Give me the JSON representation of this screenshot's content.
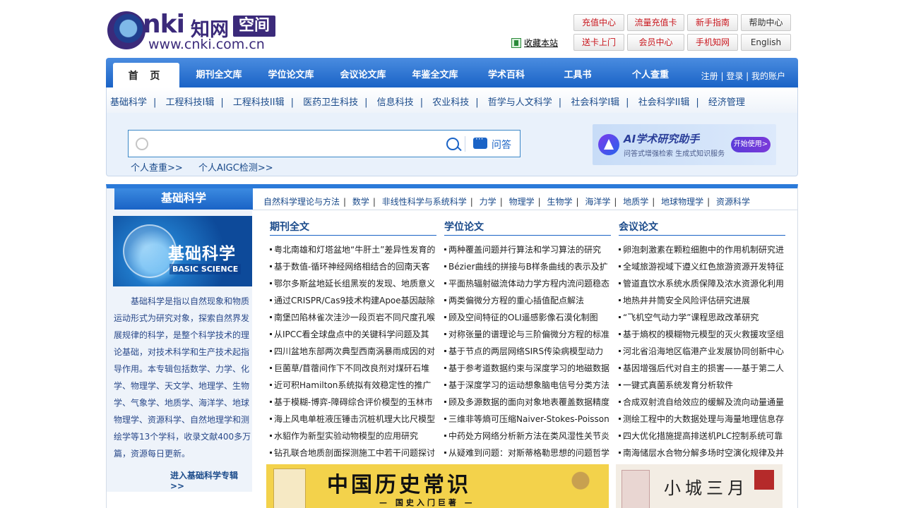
{
  "logo": {
    "brand": "nki",
    "cn": "知网",
    "box": "空间",
    "url": "www.cnki.com.cn"
  },
  "header": {
    "favorite": "收藏本站",
    "buttons_row1": [
      "充值中心",
      "流量充值卡",
      "新手指南",
      "帮助中心"
    ],
    "buttons_row2": [
      "送卡上门",
      "会员中心",
      "手机知网",
      "English"
    ]
  },
  "nav": {
    "home": "首 页",
    "items": [
      "期刊全文库",
      "学位论文库",
      "会议论文库",
      "年鉴全文库",
      "学术百科",
      "工具书",
      "个人查重"
    ],
    "account": "注册 | 登录 | 我的账户"
  },
  "subnav": [
    "基础科学",
    "工程科技I辑",
    "工程科技II辑",
    "医药卫生科技",
    "信息科技",
    "农业科技",
    "哲学与人文科学",
    "社会科学I辑",
    "社会科学II辑",
    "经济管理"
  ],
  "search": {
    "placeholder": "",
    "qa_label": "问答",
    "links": [
      "个人查重>>",
      "个人AIGC检测>>"
    ]
  },
  "ai_banner": {
    "title": "AI学术研究助手",
    "subtitle": "问答式增强检索  生成式知识服务",
    "button": "开始使用>"
  },
  "section": {
    "tab": "基础科学",
    "image_title": "基础科学",
    "image_en": "BASIC SCIENCE",
    "description": "基础科学是指以自然现象和物质运动形式为研究对象，探索自然界发展规律的科学，是整个科学技术的理论基础，对技术科学和生产技术起指导作用。本专辑包括数学、力学、化学、物理学、天文学、地理学、生物学、气象学、地质学、海洋学、地球物理学、资源科学、自然地理学和测绘学等13个学科，收录文献400多万篇，资源每日更新。",
    "enter": "进入基础科学专辑>>",
    "categories": [
      "自然科学理论与方法",
      "数学",
      "非线性科学与系统科学",
      "力学",
      "物理学",
      "生物学",
      "海洋学",
      "地质学",
      "地球物理学",
      "资源科学"
    ]
  },
  "columns": [
    {
      "title": "期刊全文",
      "items": [
        "粤北南雄和灯塔盆地“牛肝土”差异性发育的",
        "基于数值-循环神经网络相结合的回南天客",
        "鄂尔多斯盆地延长组黑炭的发现、地质意义",
        "通过CRISPR/Cas9技术构建Apoe基因敲除",
        "南堡凹陷林雀次洼沙一段页岩不同尺度孔喉",
        "从IPCC看全球盘点中的关键科学问题及其",
        "四川盆地东部两次典型西南涡暴雨成因的对",
        "巨菌草/苜蓿间作下不同改良剂对煤矸石堆",
        "近可积Hamilton系统拟有效稳定性的推广",
        "基于模糊-博弈-障碍综合评价模型的玉林市",
        "海上风电单桩液压锤击沉桩机理大比尺模型",
        "水貂作为新型实验动物模型的应用研究",
        "钻孔联合地质剖面探测施工中若干问题探讨"
      ]
    },
    {
      "title": "学位论文",
      "items": [
        "两种覆盖问题并行算法和学习算法的研究",
        "Bézier曲线的拼接与B样条曲线的表示及扩",
        "平面热辐射磁流体动力学方程内流问题稳态",
        "两类偏微分方程的重心插值配点解法",
        "顾及空间特征的OLI遥感影像石漠化制图",
        "对称张量的谱理论与三阶偏微分方程的标准",
        "基于节点的两层网络SIRS传染病模型动力",
        "基于参考道数据约束与深度学习的地磁数据",
        "基于深度学习的运动想象脑电信号分类方法",
        "顾及多源数据的面向对象地表覆盖数据精度",
        "三维非等熵可压缩Naiver-Stokes-Poisson",
        "中药处方网络分析新方法在类风湿性关节炎",
        "从疑难到问题：对斯蒂格勒思想的问题哲学"
      ]
    },
    {
      "title": "会议论文",
      "items": [
        "卵泡刺激素在颗粒细胞中的作用机制研究进",
        "全域旅游视域下遵义红色旅游资源开发特征",
        "管道直饮水系统水质保障及浓水资源化利用",
        "地热井井筒安全风险评估研究进展",
        "“飞机空气动力学”课程思政改革研究",
        "基于熵权的模糊物元模型的灭火救援攻坚组",
        "河北省沿海地区临港产业发展协同创新中心",
        "基因增强后代对自主的损害——基于第二人",
        "一键式真菌系统发育分析软件",
        "合成双射流自给效应的缓解及流向动量通量",
        "测绘工程中的大数据处理与海量地理信息存",
        "四大优化措施提高排送机PLC控制系统可靠",
        "南海储层水合物分解多场时空演化规律及并"
      ]
    }
  ],
  "books": [
    {
      "title": "中国历史常识",
      "subtitle": "— 国史入门巨著 —"
    },
    {
      "title": "小城三月"
    }
  ]
}
